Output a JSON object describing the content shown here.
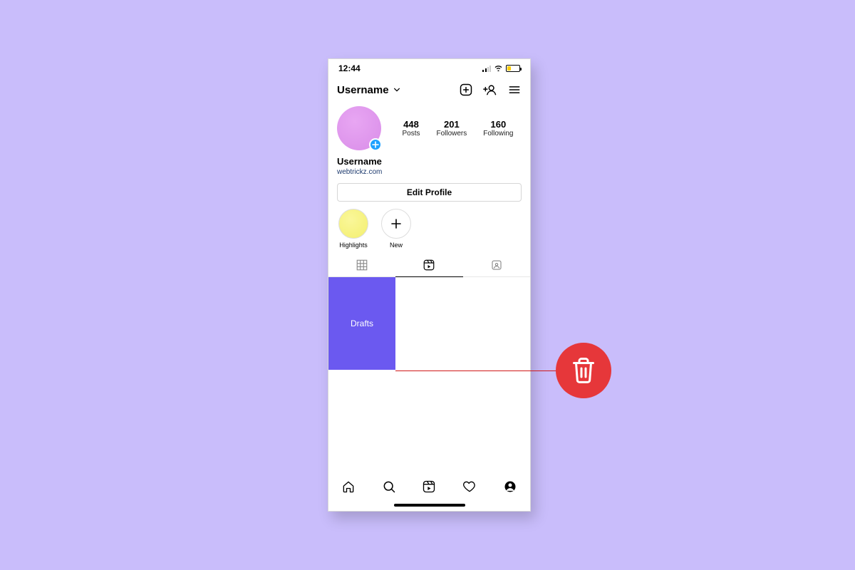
{
  "statusbar": {
    "time": "12:44"
  },
  "header": {
    "username": "Username"
  },
  "stats": {
    "posts_count": "448",
    "posts_label": "Posts",
    "followers_count": "201",
    "followers_label": "Followers",
    "following_count": "160",
    "following_label": "Following"
  },
  "profile": {
    "display_name": "Username",
    "link": "webtrickz.com",
    "edit_button": "Edit Profile"
  },
  "highlights": {
    "item0_label": "Highlights",
    "item1_label": "New"
  },
  "content": {
    "drafts_label": "Drafts"
  },
  "colors": {
    "background": "#c9bdfb",
    "drafts_tile": "#6b59f0",
    "trash_badge": "#e6373a"
  }
}
